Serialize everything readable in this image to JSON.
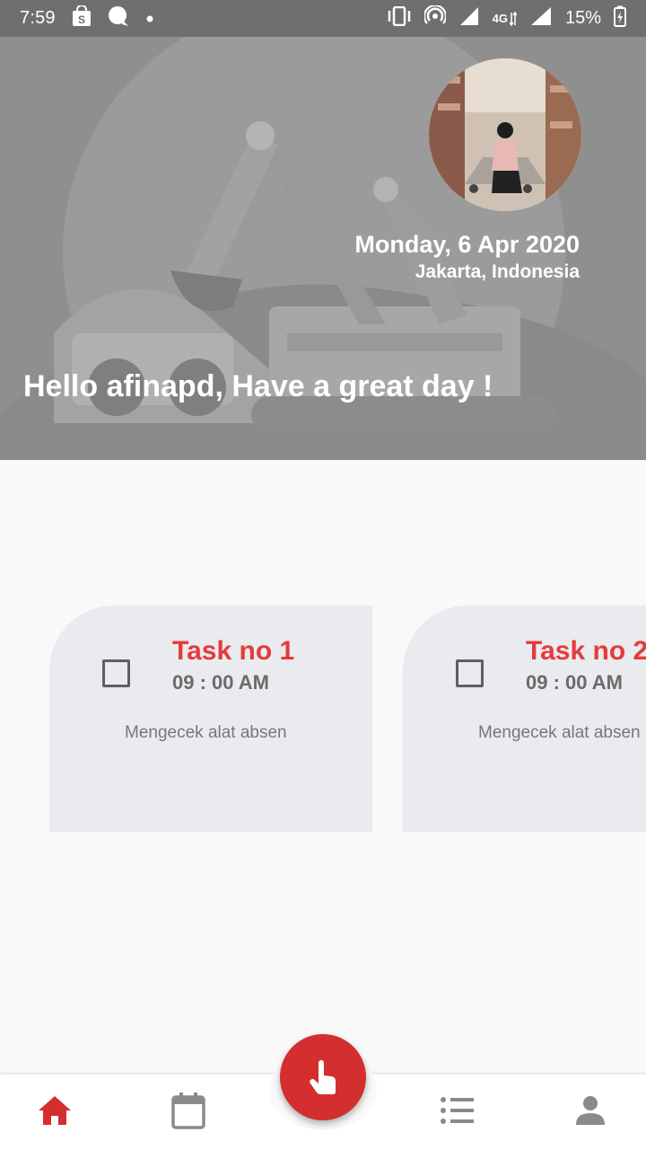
{
  "status_bar": {
    "time": "7:59",
    "network": "4G",
    "battery": "15%"
  },
  "header": {
    "date": "Monday, 6 Apr 2020",
    "location": "Jakarta, Indonesia",
    "greeting": "Hello afinapd, Have a great day !"
  },
  "tasks": [
    {
      "title": "Task no 1",
      "time": "09 : 00 AM",
      "description": "Mengecek alat absen",
      "checked": false
    },
    {
      "title": "Task no 2",
      "time": "09 : 00 AM",
      "description": "Mengecek alat absen",
      "checked": false
    }
  ],
  "bottom_nav": {
    "items": [
      {
        "icon": "home-icon",
        "active": true
      },
      {
        "icon": "calendar-icon",
        "active": false
      },
      {
        "icon": "list-icon",
        "active": false
      },
      {
        "icon": "person-icon",
        "active": false
      }
    ],
    "fab_icon": "tap-finger-icon"
  },
  "colors": {
    "accent": "#d32f2f",
    "task_title": "#e53b3b",
    "card_bg": "#e9ebee",
    "header_bg": "#8f8f8f",
    "nav_inactive": "#8a8a8a"
  }
}
